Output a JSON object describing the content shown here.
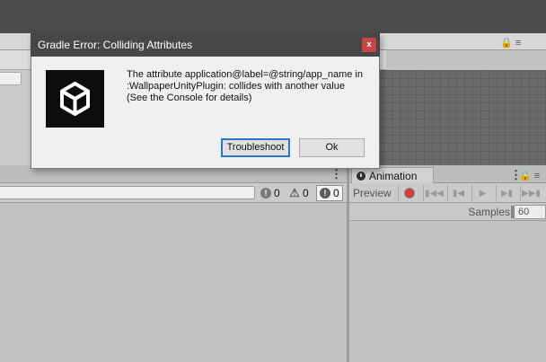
{
  "dialog": {
    "title": "Gradle Error: Colliding Attributes",
    "close_glyph": "x",
    "message_lines": [
      "The attribute application@label=@string/app_name in",
      ":WallpaperUnityPlugin: collides with another value",
      "(See the Console for details)"
    ],
    "buttons": {
      "troubleshoot": "Troubleshoot",
      "ok": "Ok"
    },
    "logo_icon": "unity-logo-icon"
  },
  "console": {
    "counts": {
      "errors": "0",
      "warnings": "0",
      "logs": "0"
    },
    "kebab": "⋮",
    "colors": {
      "error": "#7a7a7a",
      "warning": "#7a7a7a",
      "log": "#5a5a5a"
    }
  },
  "animation": {
    "tab_label": "Animation",
    "preview_label": "Preview",
    "samples_label": "Samples",
    "samples_value": "60",
    "kebab": "⋮",
    "lock_glyph": "🔒 ≡"
  },
  "top_panel": {
    "lock_glyph": "🔒 ≡"
  },
  "colors": {
    "title_bar": "#474747",
    "close_button": "#c64646",
    "primary_border": "#2b77cf",
    "record": "#d43a3a"
  }
}
